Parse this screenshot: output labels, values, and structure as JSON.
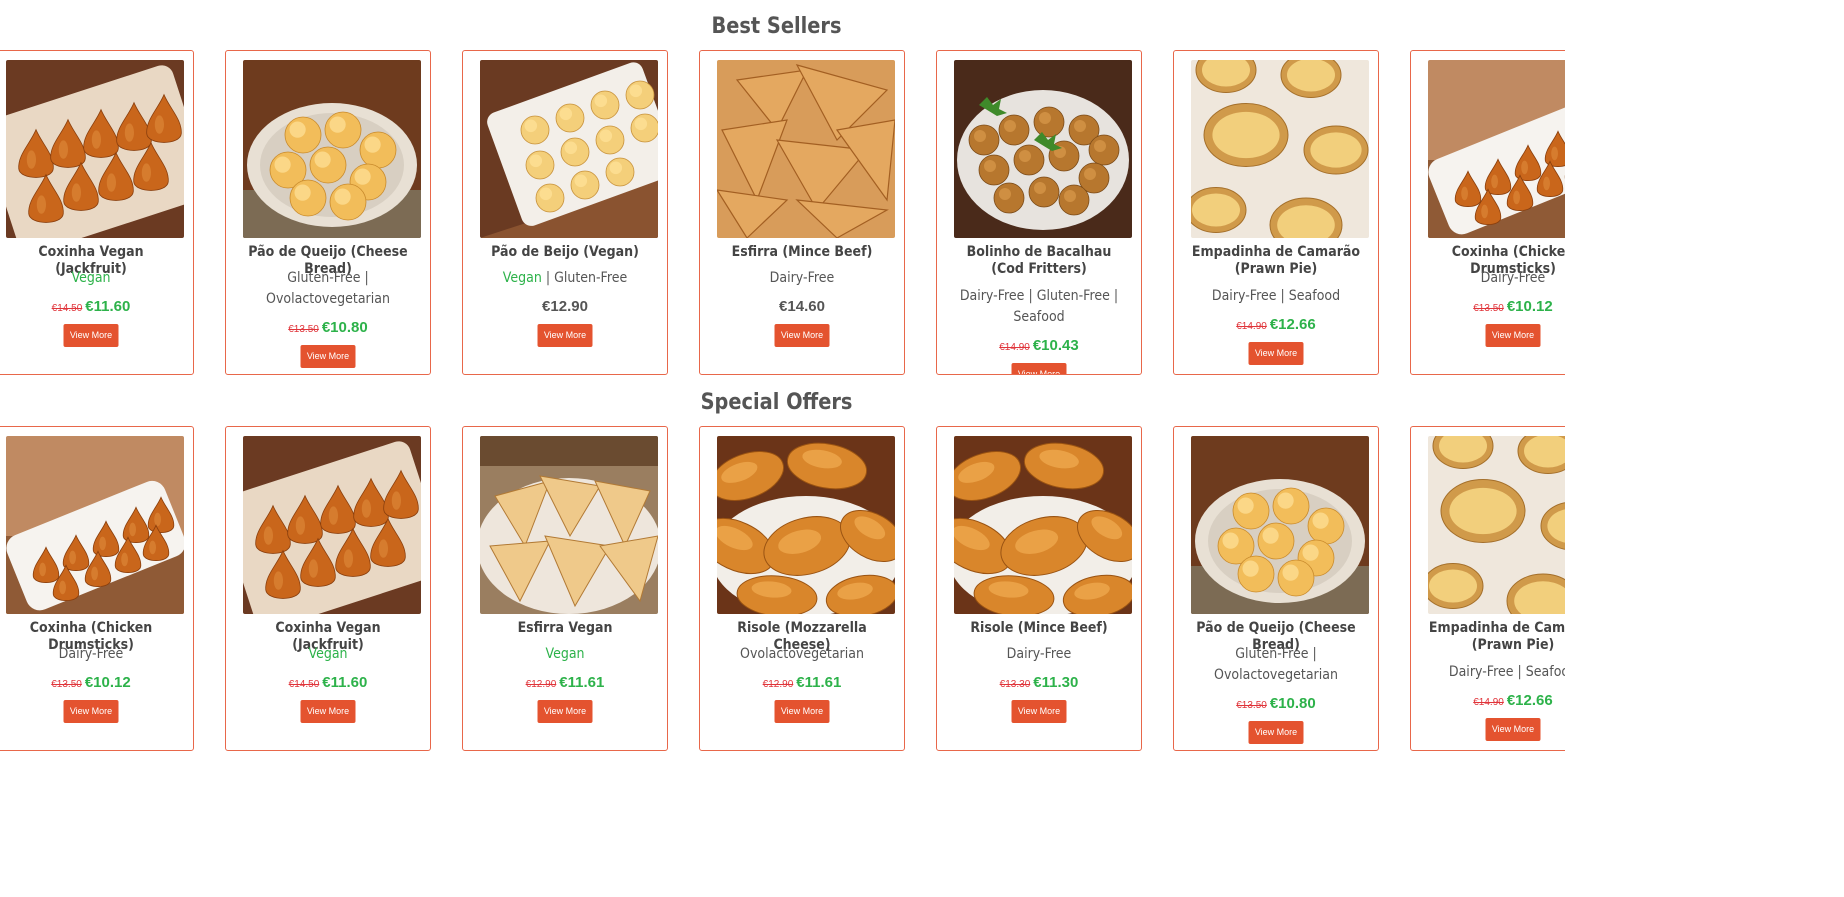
{
  "sections": [
    {
      "title": "Best Sellers",
      "products": [
        {
          "name": "Coxinha Vegan (Jackfruit)",
          "tags": [
            {
              "text": "Vegan",
              "vegan": true
            }
          ],
          "old_price": "€14.50",
          "price": "€11.60",
          "button": "View More",
          "image": "coxinha-tray-image"
        },
        {
          "name": "Pão de Queijo (Cheese Bread)",
          "tags": [
            {
              "text": "Gluten-Free",
              "vegan": false
            },
            {
              "text": "Ovolactovegetarian",
              "vegan": false
            }
          ],
          "old_price": "€13.50",
          "price": "€10.80",
          "button": "View More",
          "image": "cheese-bread-plate-image"
        },
        {
          "name": "Pão de Beijo (Vegan)",
          "tags": [
            {
              "text": "Vegan",
              "vegan": true
            },
            {
              "text": "Gluten-Free",
              "vegan": false
            }
          ],
          "old_price": "",
          "price": "€12.90",
          "button": "View More",
          "image": "cheese-bread-tray-image"
        },
        {
          "name": "Esfirra (Mince Beef)",
          "tags": [
            {
              "text": "Dairy-Free",
              "vegan": false
            }
          ],
          "old_price": "",
          "price": "€14.60",
          "button": "View More",
          "image": "esfirra-image"
        },
        {
          "name": "Bolinho de Bacalhau (Cod Fritters)",
          "tags": [
            {
              "text": "Dairy-Free",
              "vegan": false
            },
            {
              "text": "Gluten-Free",
              "vegan": false
            },
            {
              "text": "Seafood",
              "vegan": false
            }
          ],
          "old_price": "€14.90",
          "price": "€10.43",
          "button": "View More",
          "image": "cod-fritters-image"
        },
        {
          "name": "Empadinha de Camarão (Prawn Pie)",
          "tags": [
            {
              "text": "Dairy-Free",
              "vegan": false
            },
            {
              "text": "Seafood",
              "vegan": false
            }
          ],
          "old_price": "€14.90",
          "price": "€12.66",
          "button": "View More",
          "image": "prawn-pie-image"
        },
        {
          "name": "Coxinha (Chicken Drumsticks)",
          "tags": [
            {
              "text": "Dairy-Free",
              "vegan": false
            }
          ],
          "old_price": "€13.50",
          "price": "€10.12",
          "button": "View More",
          "image": "coxinha-dish-image"
        }
      ]
    },
    {
      "title": "Special Offers",
      "products": [
        {
          "name": "Coxinha (Chicken Drumsticks)",
          "tags": [
            {
              "text": "Dairy-Free",
              "vegan": false
            }
          ],
          "old_price": "€13.50",
          "price": "€10.12",
          "button": "View More",
          "image": "coxinha-dish-image"
        },
        {
          "name": "Coxinha Vegan (Jackfruit)",
          "tags": [
            {
              "text": "Vegan",
              "vegan": true
            }
          ],
          "old_price": "€14.50",
          "price": "€11.60",
          "button": "View More",
          "image": "coxinha-tray-image"
        },
        {
          "name": "Esfirra Vegan",
          "tags": [
            {
              "text": "Vegan",
              "vegan": true
            }
          ],
          "old_price": "€12.90",
          "price": "€11.61",
          "button": "View More",
          "image": "esfirra-vegan-image"
        },
        {
          "name": "Risole (Mozzarella Cheese)",
          "tags": [
            {
              "text": "Ovolactovegetarian",
              "vegan": false
            }
          ],
          "old_price": "€12.90",
          "price": "€11.61",
          "button": "View More",
          "image": "risole-image"
        },
        {
          "name": "Risole (Mince Beef)",
          "tags": [
            {
              "text": "Dairy-Free",
              "vegan": false
            }
          ],
          "old_price": "€13.30",
          "price": "€11.30",
          "button": "View More",
          "image": "risole-image"
        },
        {
          "name": "Pão de Queijo (Cheese Bread)",
          "tags": [
            {
              "text": "Gluten-Free",
              "vegan": false
            },
            {
              "text": "Ovolactovegetarian",
              "vegan": false
            }
          ],
          "old_price": "€13.50",
          "price": "€10.80",
          "button": "View More",
          "image": "cheese-bread-plate-image"
        },
        {
          "name": "Empadinha de Camarão (Prawn Pie)",
          "tags": [
            {
              "text": "Dairy-Free",
              "vegan": false
            },
            {
              "text": "Seafood",
              "vegan": false
            }
          ],
          "old_price": "€14.90",
          "price": "€12.66",
          "button": "View More",
          "image": "prawn-pie-image"
        }
      ]
    }
  ],
  "colors": {
    "accent": "#e4532f",
    "border": "#e8674a",
    "vegan": "#2db24a",
    "old_price": "#e0343a"
  }
}
